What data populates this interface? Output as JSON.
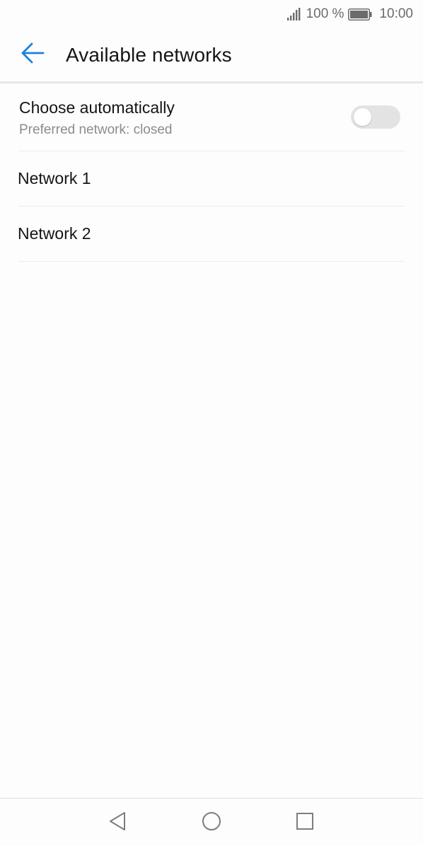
{
  "status_bar": {
    "battery_percent": "100 %",
    "time": "10:00",
    "icons": [
      "signal-icon",
      "battery-icon"
    ]
  },
  "app_bar": {
    "title": "Available networks",
    "back_icon": "arrow-left-icon"
  },
  "auto_select": {
    "title": "Choose automatically",
    "subtitle": "Preferred network: closed",
    "enabled": false
  },
  "networks": [
    {
      "label": "Network 1"
    },
    {
      "label": "Network 2"
    }
  ],
  "nav_bar": {
    "icons": [
      "nav-back-icon",
      "nav-home-icon",
      "nav-recent-icon"
    ]
  },
  "colors": {
    "accent": "#1a82e0",
    "background": "#fdfdfd",
    "text_primary": "#151515",
    "text_secondary": "#8c8c8c",
    "toggle_off": "#e3e3e3"
  }
}
